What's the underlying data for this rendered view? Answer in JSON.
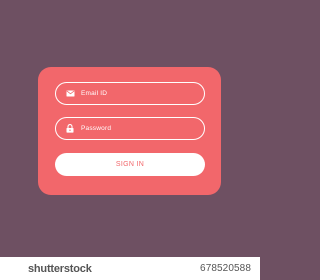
{
  "login_form": {
    "email_placeholder": "Email ID",
    "email_icon": "envelope-icon",
    "password_placeholder": "Password",
    "password_icon": "lock-icon",
    "signin_label": "SIGN IN"
  },
  "watermark": {
    "brand": "shutterstock",
    "image_id": "678520588"
  },
  "colors": {
    "background": "#6e5062",
    "card": "#f2676b",
    "field_border": "#ffffff",
    "button_bg": "#ffffff",
    "button_text": "#f2676b"
  }
}
